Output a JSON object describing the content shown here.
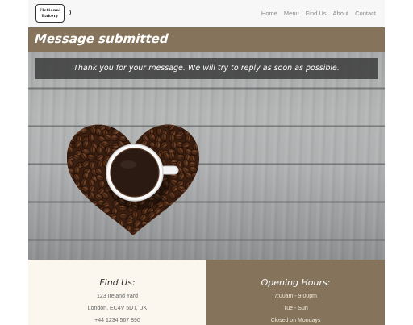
{
  "logo": {
    "line1": "Fictional",
    "line2": "Bakery"
  },
  "nav": {
    "items": [
      "Home",
      "Menu",
      "Find Us",
      "About",
      "Contact"
    ]
  },
  "page": {
    "title": "Message submitted"
  },
  "hero": {
    "message": "Thank you for your message. We will try to reply as soon as possible."
  },
  "find_us": {
    "title": "Find Us:",
    "lines": [
      "123 Ireland Yard",
      "London, EC4V 5DT, UK",
      "+44 1234 567 890"
    ]
  },
  "opening_hours": {
    "title": "Opening Hours:",
    "lines": [
      "7:00am - 9:00pm",
      "Tue - Sun",
      "Closed on Mondays"
    ]
  },
  "colors": {
    "brand_brown": "#85735b",
    "cream": "#fbf7ee",
    "nav_bg": "#f7f7f7"
  }
}
